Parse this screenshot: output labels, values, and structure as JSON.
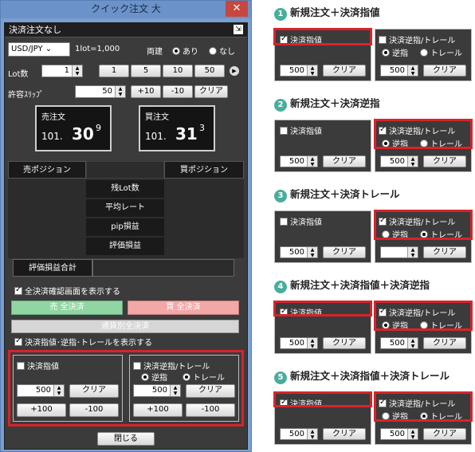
{
  "window": {
    "title": "クイック注文 大",
    "close": "✕"
  },
  "bar": {
    "label": "決済注文なし",
    "pin": "⇲"
  },
  "currency": {
    "value": "USD/JPY ⌄",
    "lot_info": "1lot=1,000"
  },
  "both": {
    "label": "両建",
    "yes": "あり",
    "no": "なし"
  },
  "lot": {
    "label": "Lot数",
    "value": "1",
    "b1": "1",
    "b5": "5",
    "b10": "10",
    "b50": "50"
  },
  "slip": {
    "label": "許容ｽﾘｯﾌﾟ",
    "value": "50",
    "plus": "+10",
    "minus": "-10",
    "clear": "クリア"
  },
  "sell": {
    "label": "売注文",
    "big": "101.",
    "mid": "30",
    "sup": "9"
  },
  "buy": {
    "label": "買注文",
    "big": "101.",
    "mid": "31",
    "sup": "3"
  },
  "positions": {
    "sell": "売ポジション",
    "buy": "買ポジション",
    "rows": [
      "残Lot数",
      "平均レート",
      "pip損益",
      "評価損益"
    ],
    "total": "評価損益合計"
  },
  "confirm": {
    "label": "全決済確認画面を表示する"
  },
  "settle": {
    "sell": "売 全決済",
    "buy": "買 全決済",
    "currency": "通貨別全決済",
    "show": "決済指値･逆指･トレールを表示する"
  },
  "limit": {
    "label": "決済指値",
    "value": "500",
    "clear": "クリア",
    "plus": "+100",
    "minus": "-100"
  },
  "stop": {
    "label": "決済逆指/トレール",
    "stop": "逆指",
    "trail": "トレール",
    "value": "500",
    "clear": "クリア",
    "plus": "+100",
    "minus": "-100"
  },
  "close_btn": "閉じる",
  "steps": [
    {
      "num": "1",
      "title": "新規注文＋決済指値"
    },
    {
      "num": "2",
      "title": "新規注文＋決済逆指"
    },
    {
      "num": "3",
      "title": "新規注文＋決済トレール"
    },
    {
      "num": "4",
      "title": "新規注文＋決済指値＋決済逆指"
    },
    {
      "num": "5",
      "title": "新規注文＋決済指値＋決済トレール"
    }
  ],
  "mini": {
    "limit": "決済指値",
    "stop": "決済逆指/トレール",
    "stop_opt": "逆指",
    "trail_opt": "トレール",
    "value": "500",
    "clear": "クリア"
  }
}
